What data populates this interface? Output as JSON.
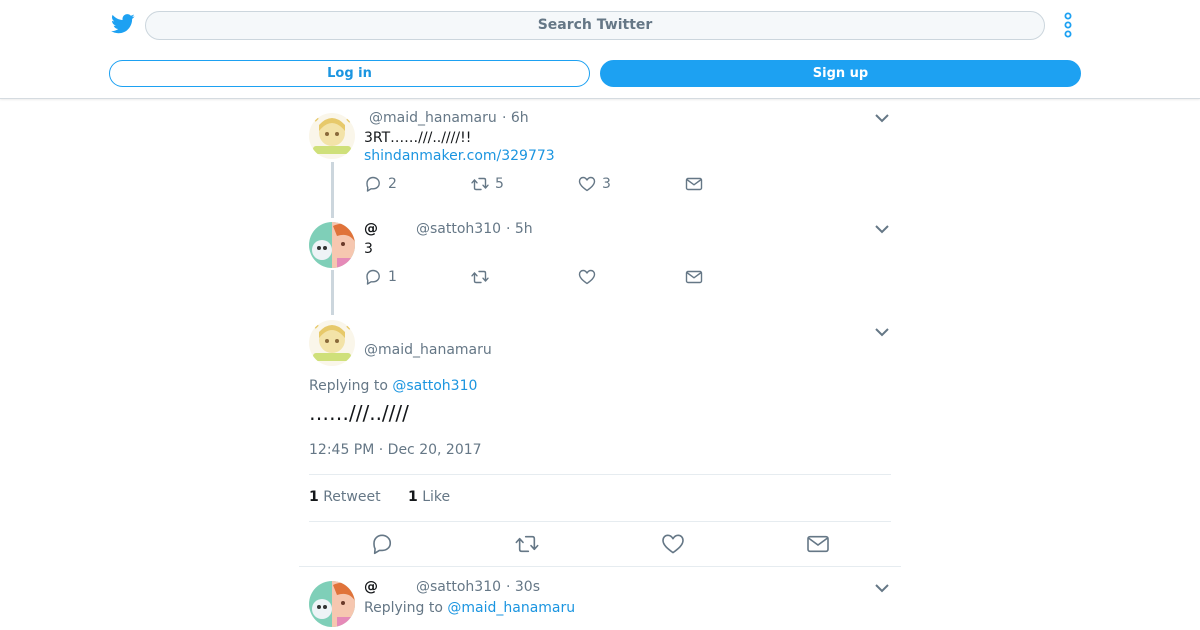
{
  "header": {
    "search_placeholder": "Search Twitter",
    "login_label": "Log in",
    "signup_label": "Sign up"
  },
  "tweets": [
    {
      "handle": "@maid_hanamaru",
      "time": "· 6h",
      "text": "3RT……///..////!!",
      "link": "shindanmaker.com/329773",
      "replies": "2",
      "retweets": "5",
      "likes": "3"
    },
    {
      "name": "@",
      "handle": "@sattoh310",
      "time": "· 5h",
      "text": "3",
      "replies": "1",
      "retweets": "",
      "likes": ""
    }
  ],
  "focused": {
    "handle": "@maid_hanamaru",
    "replying_prefix": "Replying to",
    "replying_to": "@sattoh310",
    "text": "……///..////",
    "timestamp": "12:45 PM · Dec 20, 2017",
    "retweet_count": "1",
    "retweet_label": "Retweet",
    "like_count": "1",
    "like_label": "Like"
  },
  "reply": {
    "name": "@",
    "handle": "@sattoh310",
    "time": "· 30s",
    "replying_prefix": "Replying to",
    "replying_to": "@maid_hanamaru"
  },
  "colors": {
    "brand": "#1da1f2",
    "link": "#1b95e0",
    "muted": "#657786",
    "divider": "#e6ecf0"
  },
  "icons": [
    "twitter-bird-icon",
    "more-kebab-icon",
    "chevron-down-icon",
    "reply-icon",
    "retweet-icon",
    "like-heart-icon",
    "direct-message-icon"
  ]
}
